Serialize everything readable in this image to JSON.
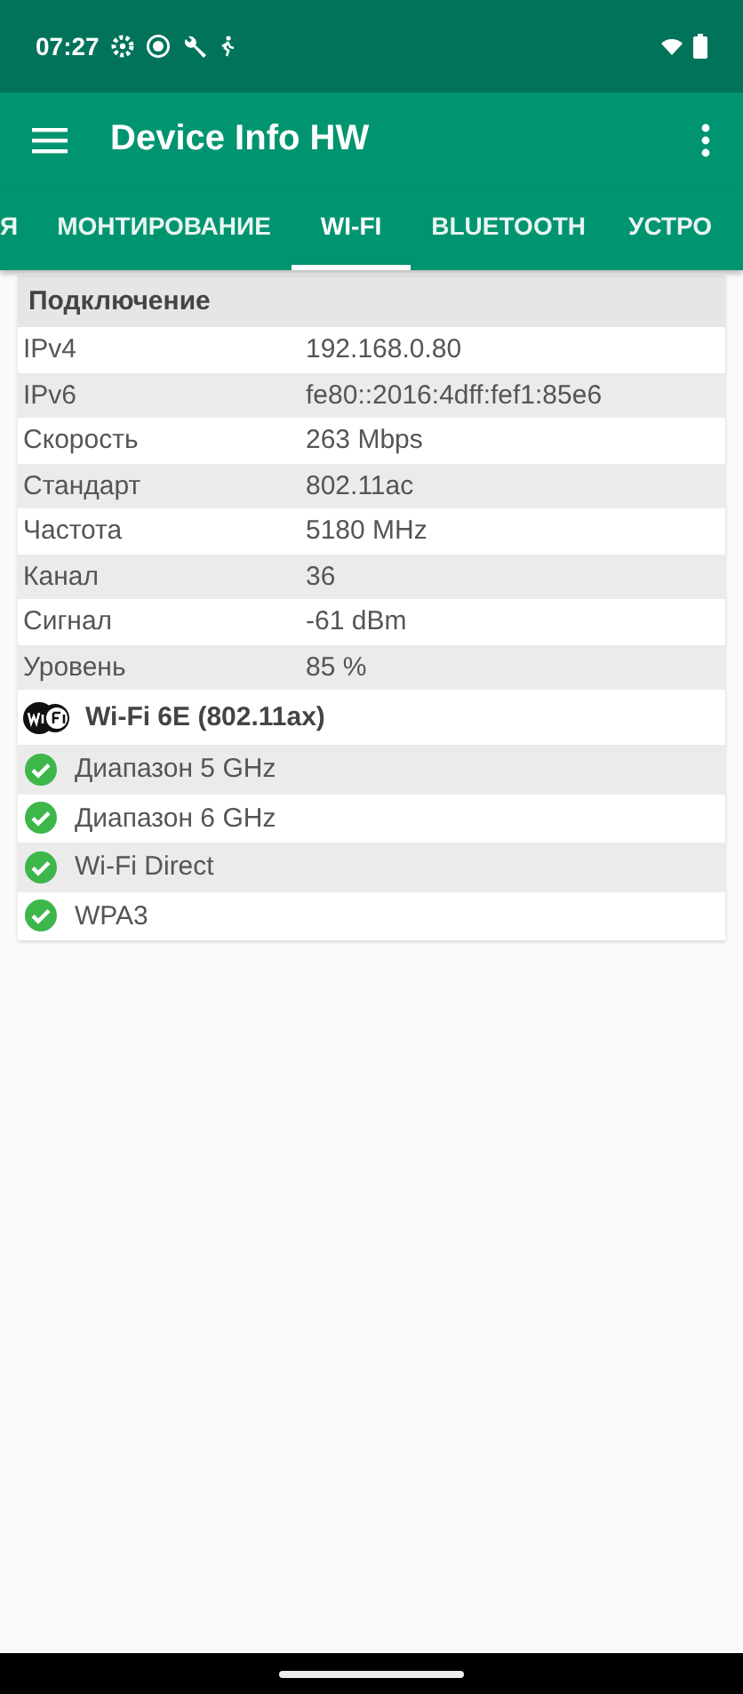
{
  "status_bar": {
    "time": "07:27"
  },
  "app_bar": {
    "title": "Device Info HW"
  },
  "tabs": [
    {
      "label": "Я",
      "selected": false
    },
    {
      "label": "МОНТИРОВАНИЕ",
      "selected": false
    },
    {
      "label": "WI-FI",
      "selected": true
    },
    {
      "label": "BLUETOOTH",
      "selected": false
    },
    {
      "label": "УСТРО",
      "selected": false
    }
  ],
  "connection": {
    "title": "Подключение",
    "rows": [
      {
        "label": "IPv4",
        "value": "192.168.0.80"
      },
      {
        "label": "IPv6",
        "value": "fe80::2016:4dff:fef1:85e6"
      },
      {
        "label": "Скорость",
        "value": "263 Mbps"
      },
      {
        "label": "Стандарт",
        "value": "802.11ac"
      },
      {
        "label": "Частота",
        "value": "5180 MHz"
      },
      {
        "label": "Канал",
        "value": "36"
      },
      {
        "label": "Сигнал",
        "value": "-61 dBm"
      },
      {
        "label": "Уровень",
        "value": "85 %"
      }
    ]
  },
  "features": {
    "title": "Wi-Fi 6E (802.11ax)",
    "items": [
      {
        "label": "Диапазон 5 GHz",
        "supported": true
      },
      {
        "label": "Диапазон 6 GHz",
        "supported": true
      },
      {
        "label": "Wi-Fi Direct",
        "supported": true
      },
      {
        "label": "WPA3",
        "supported": true
      }
    ]
  }
}
